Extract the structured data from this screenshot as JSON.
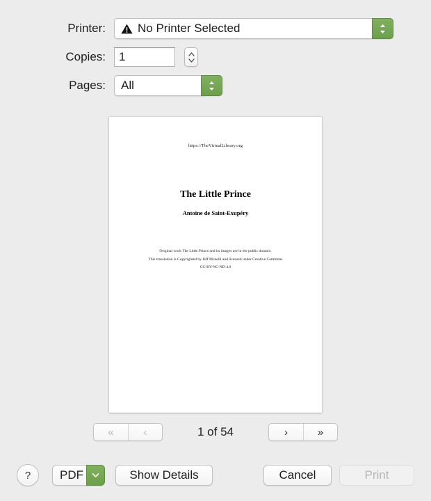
{
  "dialog": {
    "printer_row": {
      "label": "Printer:",
      "value": "No Printer Selected",
      "warning_icon": "warning-triangle-icon",
      "accent_color": "#6ba04a"
    },
    "copies_row": {
      "label": "Copies:",
      "value": "1",
      "stepper_icon": "up-down-chevron-icon"
    },
    "pages_row": {
      "label": "Pages:",
      "value": "All",
      "accent_color": "#6ba04a"
    }
  },
  "preview": {
    "url": "https://TheVirtualLibrary.org",
    "title": "The Little Prince",
    "author": "Antoine de Saint-Exupéry",
    "notice_line1": "Original work The Little Prince and its images are in the public domain.",
    "notice_line2": "This translation is Copyrighted by Jeff Mcneill and licensed under Creative Commons",
    "notice_line3": "CC-BY-NC-ND 4.0"
  },
  "pager": {
    "first_label": "«",
    "prev_label": "‹",
    "count": "1 of 54",
    "next_label": "›",
    "last_label": "»"
  },
  "bottom_bar": {
    "help_label": "?",
    "pdf_label": "PDF",
    "pdf_arrow_icon": "chevron-down-icon",
    "show_details_label": "Show Details",
    "cancel_label": "Cancel",
    "print_label": "Print"
  }
}
